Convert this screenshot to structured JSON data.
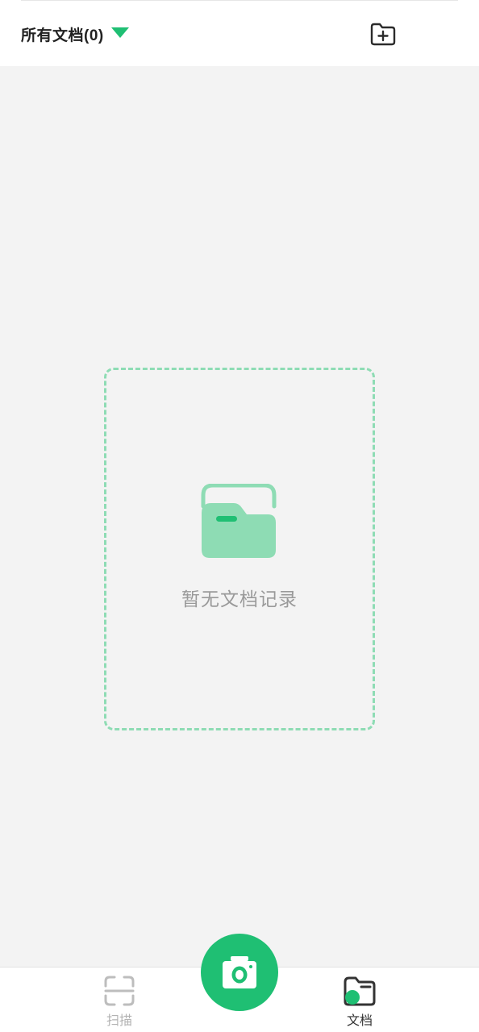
{
  "header": {
    "filter_label": "所有文档(0)",
    "caret_icon": "triangle-down-icon",
    "add_folder_icon": "folder-plus-icon"
  },
  "empty_state": {
    "icon": "folder-icon",
    "message": "暂无文档记录"
  },
  "bottom_nav": {
    "items": [
      {
        "label": "扫描",
        "icon": "scan-icon",
        "active": false
      },
      {
        "label": "文档",
        "icon": "documents-folder-icon",
        "active": true
      }
    ],
    "center_button_icon": "camera-icon"
  },
  "colors": {
    "accent": "#1fbf73",
    "accent_light": "#8edcb4",
    "background": "#f3f3f3",
    "muted_text": "#9a9a9a"
  }
}
